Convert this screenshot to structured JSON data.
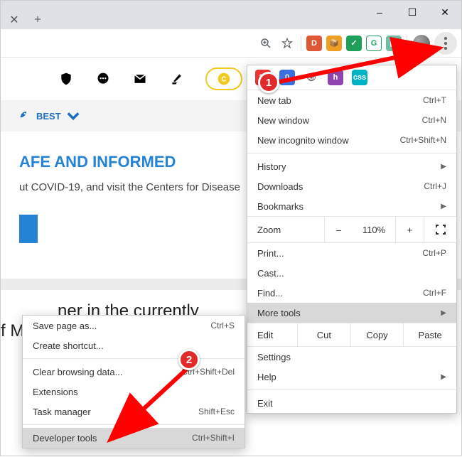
{
  "window": {
    "minimize": "–",
    "maximize": "☐",
    "close": "✕"
  },
  "tabs": {
    "close": "✕"
  },
  "category": {
    "label": "BEST"
  },
  "banner": {
    "headline": "AFE AND INFORMED",
    "sub": "ut COVID-19, and visit the Centers for Disease"
  },
  "article_fragment": "            ner in the currently\nf Milan",
  "menu": {
    "new_tab": "New tab",
    "new_tab_sc": "Ctrl+T",
    "new_window": "New window",
    "new_window_sc": "Ctrl+N",
    "incognito": "New incognito window",
    "incognito_sc": "Ctrl+Shift+N",
    "history": "History",
    "downloads": "Downloads",
    "downloads_sc": "Ctrl+J",
    "bookmarks": "Bookmarks",
    "zoom_label": "Zoom",
    "zoom_minus": "–",
    "zoom_val": "110%",
    "zoom_plus": "+",
    "print": "Print...",
    "print_sc": "Ctrl+P",
    "cast": "Cast...",
    "find": "Find...",
    "find_sc": "Ctrl+F",
    "more_tools": "More tools",
    "edit_label": "Edit",
    "cut": "Cut",
    "copy": "Copy",
    "paste": "Paste",
    "settings": "Settings",
    "help": "Help",
    "exit": "Exit"
  },
  "submenu": {
    "save_as": "Save page as...",
    "save_as_sc": "Ctrl+S",
    "create_shortcut": "Create shortcut...",
    "clear_data": "Clear browsing data...",
    "clear_data_sc": "Ctrl+Shift+Del",
    "extensions": "Extensions",
    "task_manager": "Task manager",
    "task_manager_sc": "Shift+Esc",
    "dev_tools": "Developer tools",
    "dev_tools_sc": "Ctrl+Shift+I"
  },
  "annotations": {
    "step1": "1",
    "step2": "2"
  }
}
